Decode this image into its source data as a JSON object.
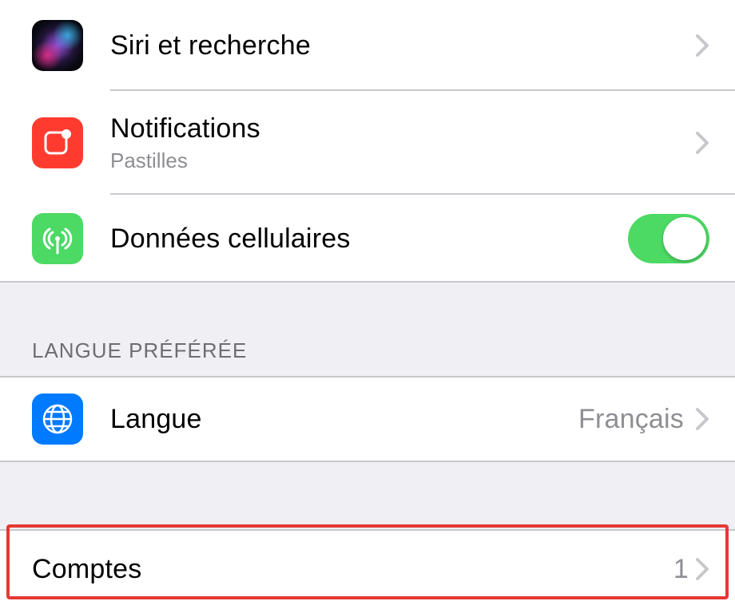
{
  "section1": {
    "siri": {
      "label": "Siri et recherche"
    },
    "notifications": {
      "label": "Notifications",
      "sublabel": "Pastilles"
    },
    "cellular": {
      "label": "Données cellulaires",
      "enabled": true
    }
  },
  "section2": {
    "header": "Langue préférée",
    "language": {
      "label": "Langue",
      "value": "Français"
    }
  },
  "section3": {
    "accounts": {
      "label": "Comptes",
      "value": "1"
    }
  }
}
